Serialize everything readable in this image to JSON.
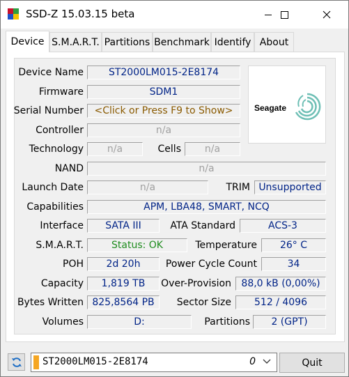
{
  "window": {
    "title": "SSD-Z 15.03.15 beta",
    "icon_colors": [
      "#c8102e",
      "#2e9e3f",
      "#1e50c8",
      "#f5c400"
    ]
  },
  "tabs": [
    {
      "label": "Device",
      "active": true
    },
    {
      "label": "S.M.A.R.T.",
      "active": false
    },
    {
      "label": "Partitions",
      "active": false
    },
    {
      "label": "Benchmark",
      "active": false
    },
    {
      "label": "Identify",
      "active": false
    },
    {
      "label": "About",
      "active": false
    }
  ],
  "device": {
    "device_name": {
      "label": "Device Name",
      "value": "ST2000LM015-2E8174"
    },
    "firmware": {
      "label": "Firmware",
      "value": "SDM1"
    },
    "serial": {
      "label": "Serial Number",
      "value": "<Click or Press F9 to Show>"
    },
    "controller": {
      "label": "Controller",
      "value": "n/a"
    },
    "technology": {
      "label": "Technology",
      "value": "n/a"
    },
    "cells": {
      "label": "Cells",
      "value": "n/a"
    },
    "nand": {
      "label": "NAND",
      "value": "n/a"
    },
    "launch_date": {
      "label": "Launch Date",
      "value": "n/a"
    },
    "trim": {
      "label": "TRIM",
      "value": "Unsupported"
    },
    "capabilities": {
      "label": "Capabilities",
      "value": "APM, LBA48, SMART, NCQ"
    },
    "interface": {
      "label": "Interface",
      "value": "SATA III"
    },
    "ata_standard": {
      "label": "ATA Standard",
      "value": "ACS-3"
    },
    "smart": {
      "label": "S.M.A.R.T.",
      "value": "Status: OK"
    },
    "temperature": {
      "label": "Temperature",
      "value": "26° C"
    },
    "poh": {
      "label": "POH",
      "value": "2d 20h"
    },
    "power_cycle": {
      "label": "Power Cycle Count",
      "value": "34"
    },
    "capacity": {
      "label": "Capacity",
      "value": "1,819 TB"
    },
    "over_provision": {
      "label": "Over-Provision",
      "value": "88,0 kB (0,00%)"
    },
    "bytes_written": {
      "label": "Bytes Written",
      "value": "825,8564 PB"
    },
    "sector_size": {
      "label": "Sector Size",
      "value": "512 / 4096"
    },
    "volumes": {
      "label": "Volumes",
      "value": "D:"
    },
    "partitions": {
      "label": "Partitions",
      "value": "2 (GPT)"
    }
  },
  "logo": {
    "brand": "Seagate",
    "color": "#6ebfb5"
  },
  "bottom": {
    "drive_select": "ST2000LM015-2E8174",
    "drive_index": "0",
    "quit_label": "Quit"
  }
}
